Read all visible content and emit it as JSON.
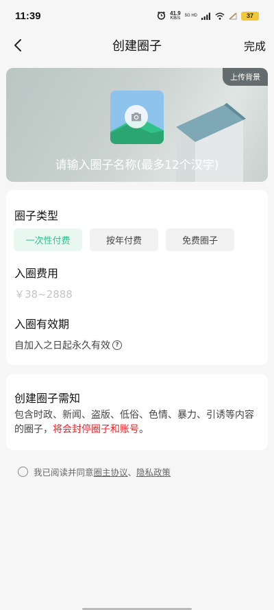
{
  "status_bar": {
    "time": "11:39",
    "net_speed_value": "41.9",
    "net_speed_unit": "KB/s",
    "signal_label": "5G HD",
    "battery": "37"
  },
  "nav": {
    "title": "创建圈子",
    "done_label": "完成"
  },
  "banner": {
    "upload_bg_label": "上传背景",
    "name_hint": "请输入圈子名称(最多12个汉字)"
  },
  "form": {
    "type_label": "圈子类型",
    "type_options": [
      "一次性付费",
      "按年付费",
      "免费圈子"
    ],
    "selected_type": "一次性付费",
    "fee_label": "入圈费用",
    "fee_placeholder": "￥38~2888",
    "validity_label": "入圈有效期",
    "validity_value": "自加入之日起永久有效"
  },
  "notice": {
    "title": "创建圈子需知",
    "body_normal": "包含时政、新闻、盗版、低俗、色情、暴力、引诱等内容的圈子，",
    "body_warning": "将会封停圈子和账号",
    "body_end": "。"
  },
  "agreement": {
    "prefix": "我已阅读并同意 ",
    "link1": "圈主协议",
    "separator": "、",
    "link2": "隐私政策"
  },
  "colors": {
    "accent": "#2fc08b",
    "warning": "#e8242b"
  }
}
